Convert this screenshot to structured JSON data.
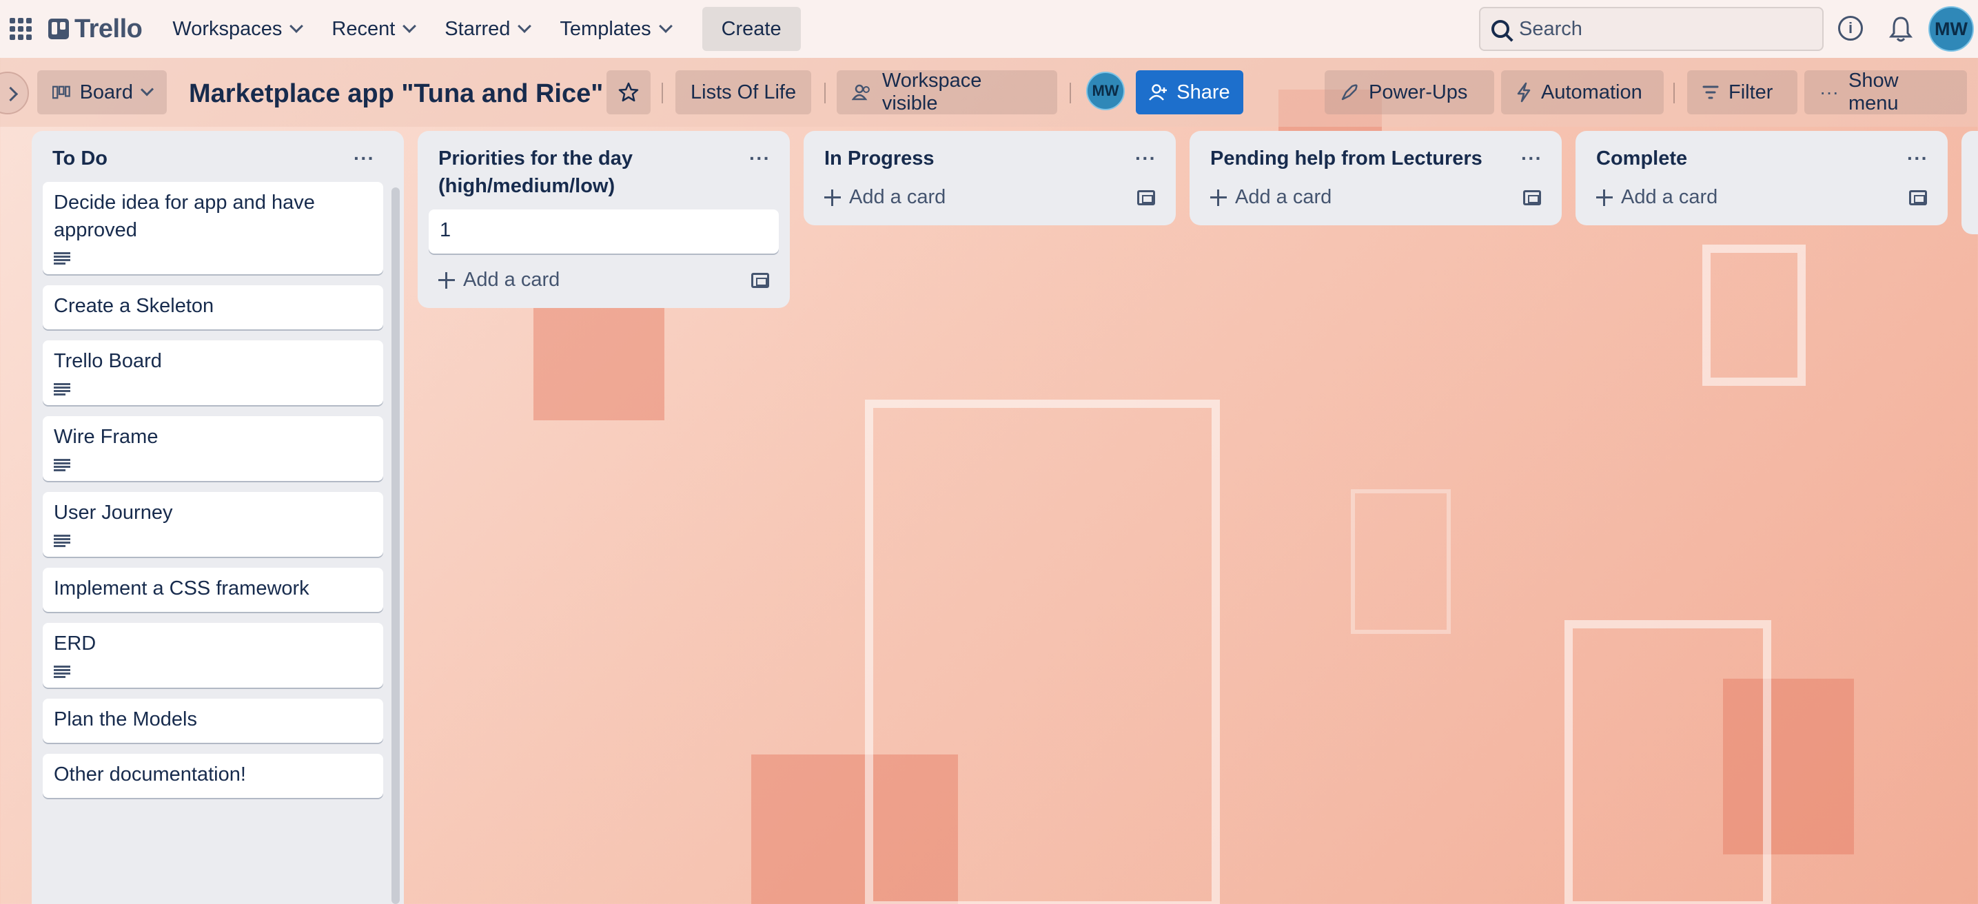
{
  "header": {
    "logo": "Trello",
    "nav": [
      "Workspaces",
      "Recent",
      "Starred",
      "Templates"
    ],
    "create": "Create",
    "search_placeholder": "Search",
    "avatar": "MW"
  },
  "boardbar": {
    "view": "Board",
    "title": "Marketplace app \"Tuna and Rice\"",
    "workspace_name": "Lists Of Life",
    "visibility": "Workspace visible",
    "member": "MW",
    "share": "Share",
    "powerups": "Power-Ups",
    "automation": "Automation",
    "filter": "Filter",
    "show_menu": "Show menu"
  },
  "lists": [
    {
      "title": "To Do",
      "cards": [
        {
          "title": "Decide idea for app and have approved",
          "has_description": true
        },
        {
          "title": "Create a Skeleton",
          "has_description": false
        },
        {
          "title": "Trello Board",
          "has_description": true
        },
        {
          "title": "Wire Frame",
          "has_description": true
        },
        {
          "title": "User Journey",
          "has_description": true
        },
        {
          "title": "Implement a CSS framework",
          "has_description": false
        },
        {
          "title": "ERD",
          "has_description": true
        },
        {
          "title": "Plan the Models",
          "has_description": false
        },
        {
          "title": "Other documentation!",
          "has_description": false
        }
      ]
    },
    {
      "title": "Priorities for the day (high/medium/low)",
      "cards": [
        {
          "title": "1",
          "has_description": false
        }
      ],
      "add_card": "Add a card"
    },
    {
      "title": "In Progress",
      "cards": [],
      "add_card": "Add a card"
    },
    {
      "title": "Pending help from Lecturers",
      "cards": [],
      "add_card": "Add a card"
    },
    {
      "title": "Complete",
      "cards": [],
      "add_card": "Add a card"
    }
  ],
  "colors": {
    "share": "#1d6fcc",
    "avatar": "#2f88b8",
    "list_bg": "#ebecf0",
    "background": "#f7c9b8"
  }
}
